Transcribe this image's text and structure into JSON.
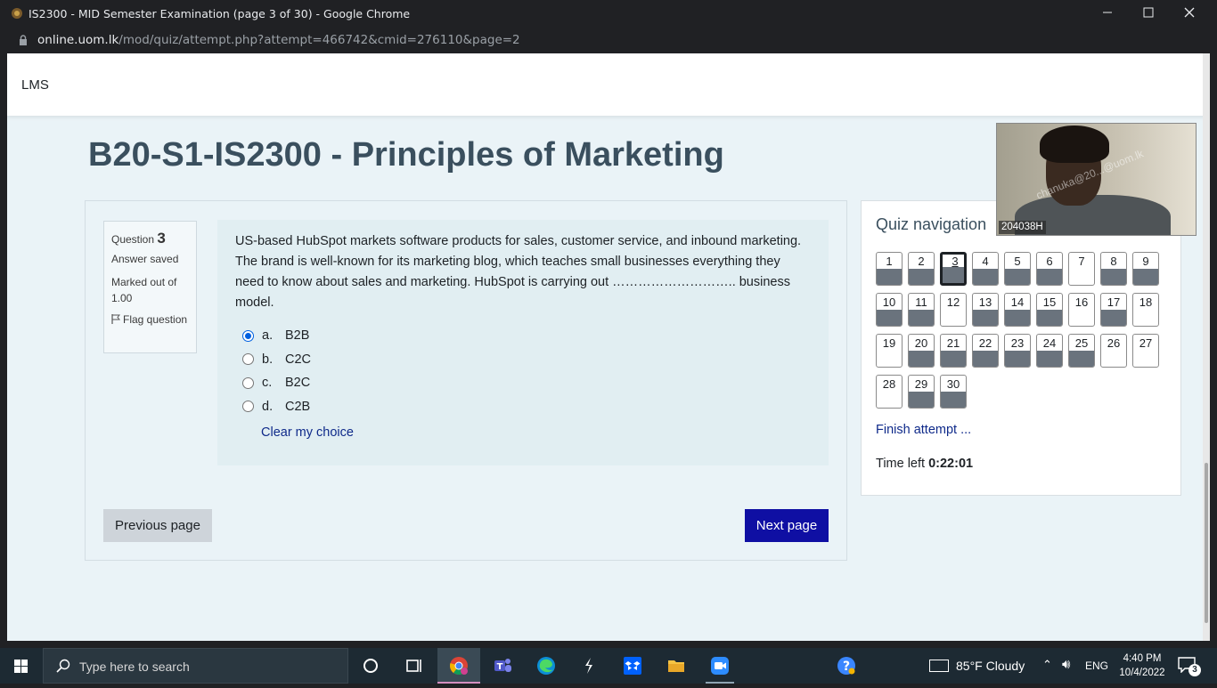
{
  "window": {
    "title": "IS2300 - MID Semester Examination (page 3 of 30) - Google Chrome",
    "url_host": "online.uom.lk",
    "url_path": "/mod/quiz/attempt.php?attempt=466742&cmid=276110&page=2"
  },
  "site": {
    "brand": "LMS",
    "course_title": "B20-S1-IS2300 - Principles of Marketing"
  },
  "question": {
    "label": "Question",
    "number": "3",
    "state": "Answer saved",
    "grade": "Marked out of 1.00",
    "flag_label": "Flag question",
    "text": "US-based HubSpot markets software products for sales, customer service, and inbound marketing. The brand is well-known for its marketing blog, which teaches small businesses everything they need to know about sales and marketing. HubSpot is carrying out ……………………….. business model.",
    "answers": [
      {
        "letter": "a.",
        "text": "B2B",
        "selected": true
      },
      {
        "letter": "b.",
        "text": "C2C",
        "selected": false
      },
      {
        "letter": "c.",
        "text": "B2C",
        "selected": false
      },
      {
        "letter": "d.",
        "text": "C2B",
        "selected": false
      }
    ],
    "clear_label": "Clear my choice"
  },
  "buttons": {
    "previous": "Previous page",
    "next": "Next page"
  },
  "quiz_nav": {
    "title": "Quiz navigation",
    "current": 3,
    "answered": [
      1,
      2,
      3,
      4,
      5,
      6,
      8,
      9,
      10,
      11,
      13,
      14,
      15,
      17,
      20,
      21,
      22,
      23,
      24,
      25,
      29,
      30
    ],
    "labels": [
      "1",
      "2",
      "3",
      "4",
      "5",
      "6",
      "7",
      "8",
      "9",
      "10",
      "11",
      "12",
      "13",
      "14",
      "15",
      "16",
      "17",
      "18",
      "19",
      "20",
      "21",
      "22",
      "23",
      "24",
      "25",
      "26",
      "27",
      "28",
      "29",
      "30"
    ],
    "finish_label": "Finish attempt ...",
    "time_label": "Time left",
    "time_value": "0:22:01"
  },
  "webcam": {
    "id_label": "204038H",
    "watermark": "chanuka@20...@uom.lk"
  },
  "taskbar": {
    "search_placeholder": "Type here to search",
    "weather": "85°F  Cloudy",
    "language": "ENG",
    "time": "4:40 PM",
    "date": "10/4/2022",
    "notifications": "3",
    "apps": [
      "task-view",
      "chrome",
      "teams",
      "edge",
      "sublime",
      "dropbox",
      "file-explorer",
      "zoom",
      "help"
    ]
  },
  "colors": {
    "accent": "#0f0fa3",
    "link": "#0f2a8a",
    "page_bg": "#eaf3f7",
    "answered_fill": "#6a737d"
  }
}
